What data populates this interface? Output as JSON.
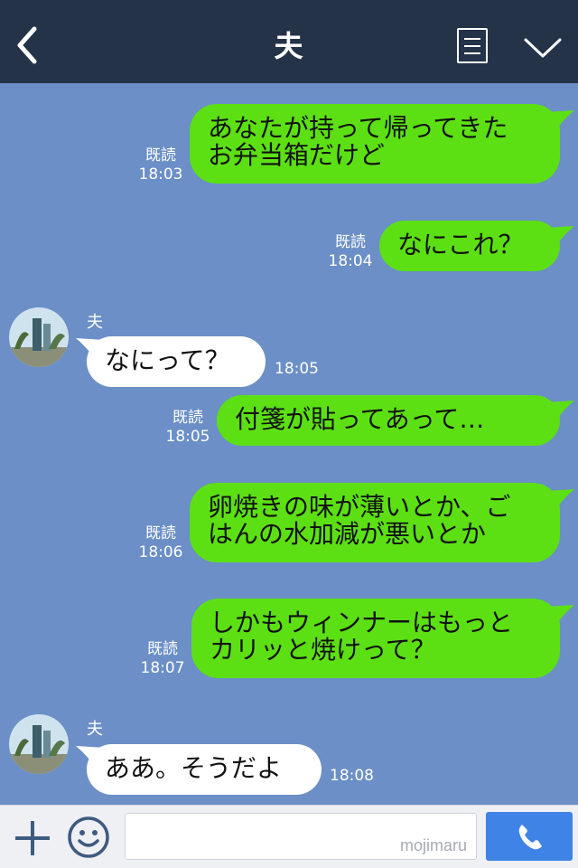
{
  "header": {
    "title": "夫"
  },
  "messages": [
    {
      "direction": "out",
      "lines": [
        "あなたが持って帰ってきた",
        "お弁当箱だけど"
      ],
      "status": "既読",
      "time": "18:03"
    },
    {
      "direction": "out",
      "lines": [
        "なにこれ？"
      ],
      "status": "既読",
      "time": "18:04"
    },
    {
      "direction": "in",
      "sender": "夫",
      "lines": [
        "なにって？"
      ],
      "time": "18:05"
    },
    {
      "direction": "out",
      "lines": [
        "付箋が貼ってあって…"
      ],
      "status": "既読",
      "time": "18:05"
    },
    {
      "direction": "out",
      "lines": [
        "卵焼きの味が薄いとか、ご",
        "はんの水加減が悪いとか"
      ],
      "status": "既読",
      "time": "18:06"
    },
    {
      "direction": "out",
      "lines": [
        "しかもウィンナーはもっと",
        "カリッと焼けって？"
      ],
      "status": "既読",
      "time": "18:07"
    },
    {
      "direction": "in",
      "sender": "夫",
      "lines": [
        "ああ。そうだよ"
      ],
      "time": "18:08"
    }
  ],
  "footer": {
    "input_value": "",
    "watermark": "mojimaru"
  },
  "icons": {
    "back": "back-chevron-icon",
    "note": "note-icon",
    "menu": "chevron-down-icon",
    "plus": "plus-icon",
    "emoji": "smiley-icon",
    "call": "phone-icon",
    "avatar": "avatar-photo"
  },
  "colors": {
    "header_bg": "#253349",
    "chat_bg": "#6b8fc6",
    "outgoing_bubble": "#5ce014",
    "incoming_bubble": "#ffffff",
    "call_button": "#3f83e6"
  }
}
